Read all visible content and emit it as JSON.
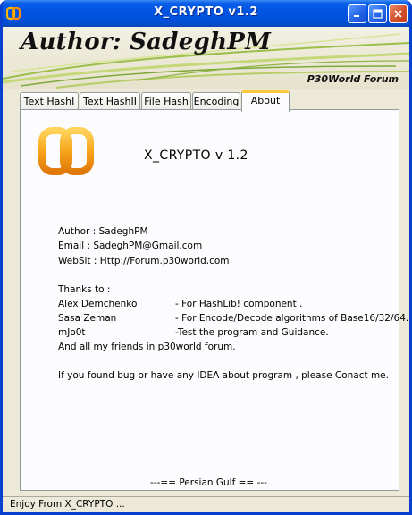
{
  "window": {
    "title": "X_CRYPTO   v1.2"
  },
  "banner": {
    "author": "Author: SadeghPM",
    "forum": "P30World Forum"
  },
  "tabs": [
    {
      "label": "Text HashI"
    },
    {
      "label": "Text HashII"
    },
    {
      "label": "File Hash"
    },
    {
      "label": "Encoding"
    },
    {
      "label": "About",
      "active": true
    }
  ],
  "about": {
    "app_name": "X_CRYPTO v 1.2",
    "author_line": "Author : SadeghPM",
    "email_line": "Email    : SadeghPM@Gmail.com",
    "website_line": "WebSit : Http://Forum.p30world.com",
    "thanks_heading": "Thanks to :",
    "thanks": [
      {
        "name": "Alex Demchenko",
        "desc": "- For HashLib! component ."
      },
      {
        "name": "Sasa Zeman",
        "desc": "- For Encode/Decode algorithms of Base16/32/64."
      },
      {
        "name": "mJo0t",
        "desc": "-Test the program and Guidance."
      }
    ],
    "friends_line": "And all my friends in p30world forum.",
    "bug_line": "If you found bug or have any IDEA about program , please Conact me.",
    "footer": "---== Persian Gulf == ---"
  },
  "status": {
    "text": "Enjoy From X_CRYPTO ..."
  },
  "colors": {
    "titlebar": "#0054e3",
    "tab_active_accent": "#ffc83c",
    "logo_orange": "#f59a14"
  }
}
